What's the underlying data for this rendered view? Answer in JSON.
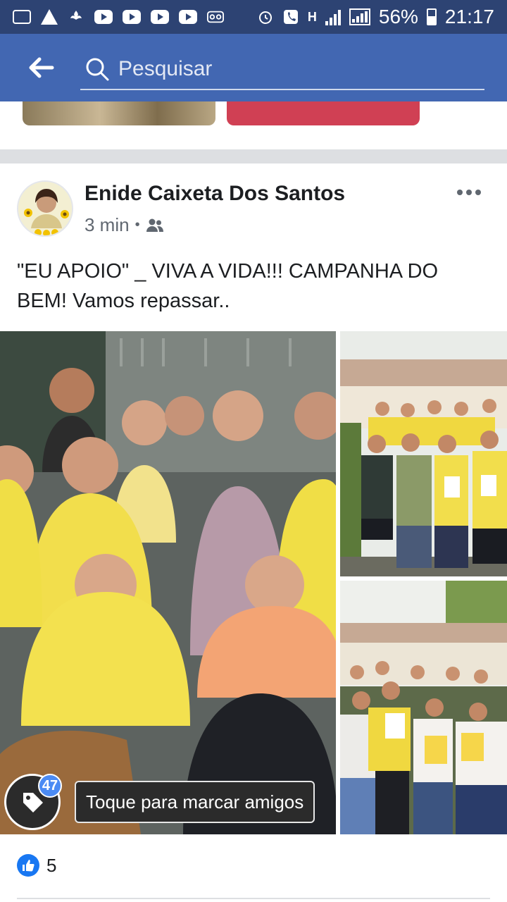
{
  "status_bar": {
    "battery": "56%",
    "time": "21:17",
    "network": "H"
  },
  "search": {
    "placeholder": "Pesquisar"
  },
  "post": {
    "author": "Enide Caixeta Dos Santos",
    "time": "3 min",
    "separator": "•",
    "text": "\"EU APOIO\" _ VIVA A VIDA!!! CAMPANHA DO BEM!  Vamos repassar..",
    "tag_count": "47",
    "tag_hint": "Toque para marcar amigos",
    "like_count": "5"
  },
  "colors": {
    "status_bar": "#2d4373",
    "app_bar": "#4267b2",
    "like": "#1877f2",
    "tag_badge": "#4b8bf4"
  },
  "icons": [
    "gallery-icon",
    "warning-icon",
    "santander-icon",
    "youtube-icon",
    "voicemail-icon",
    "alarm-icon",
    "phone-icon",
    "signal-icon",
    "battery-icon",
    "back-arrow-icon",
    "search-icon",
    "friends-icon",
    "more-icon",
    "tag-icon",
    "like-icon"
  ]
}
